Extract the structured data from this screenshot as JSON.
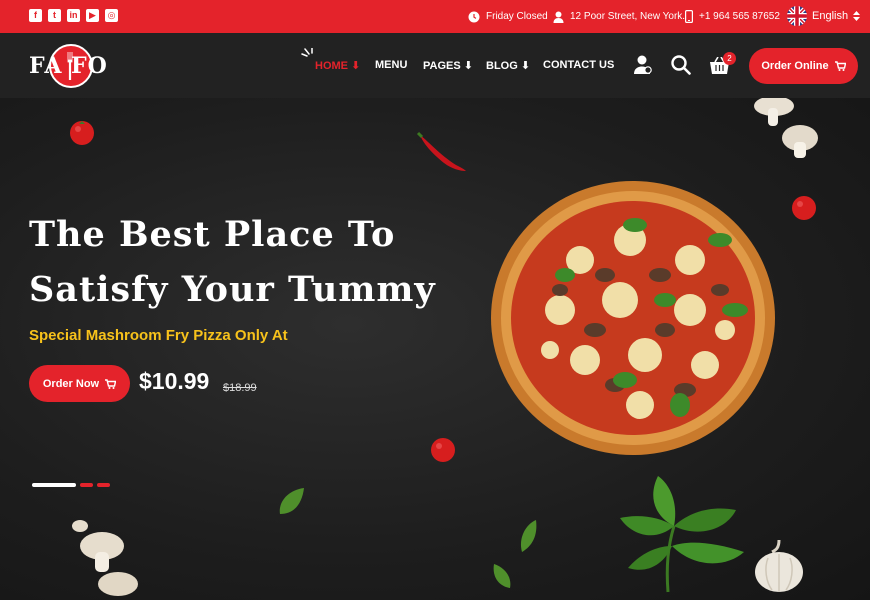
{
  "topbar": {
    "social": [
      {
        "icon": "facebook-icon",
        "glyph": "f"
      },
      {
        "icon": "twitter-icon",
        "glyph": "t"
      },
      {
        "icon": "linkedin-icon",
        "glyph": "in"
      },
      {
        "icon": "youtube-icon",
        "glyph": "▶"
      },
      {
        "icon": "instagram-icon",
        "glyph": "◎"
      }
    ],
    "hours": "Friday Closed",
    "address": "12 Poor Street, New York.",
    "phone": "+1 964 565 87652",
    "language": "English"
  },
  "header": {
    "logo_text": "FA  FO",
    "nav": [
      {
        "label": "HOME",
        "active": true,
        "dropdown": true
      },
      {
        "label": "MENU",
        "active": false,
        "dropdown": false
      },
      {
        "label": "PAGES",
        "active": false,
        "dropdown": true
      },
      {
        "label": "BLOG",
        "active": false,
        "dropdown": true
      },
      {
        "label": "CONTACT US",
        "active": false,
        "dropdown": false
      }
    ],
    "cart_count": "2",
    "order_online_label": "Order Online"
  },
  "hero": {
    "headline_line1": "The Best Place To",
    "headline_line2": "Satisfy Your Tummy",
    "subheadline": "Special Mashroom Fry Pizza Only At",
    "order_now_label": "Order Now",
    "price": "$10.99",
    "old_price": "$18.99",
    "slides": {
      "total": 3,
      "active": 1
    }
  },
  "colors": {
    "accent": "#e4232b",
    "highlight": "#f7c21b",
    "header_bg": "#222222",
    "hero_bg": "#1d1d1d"
  }
}
